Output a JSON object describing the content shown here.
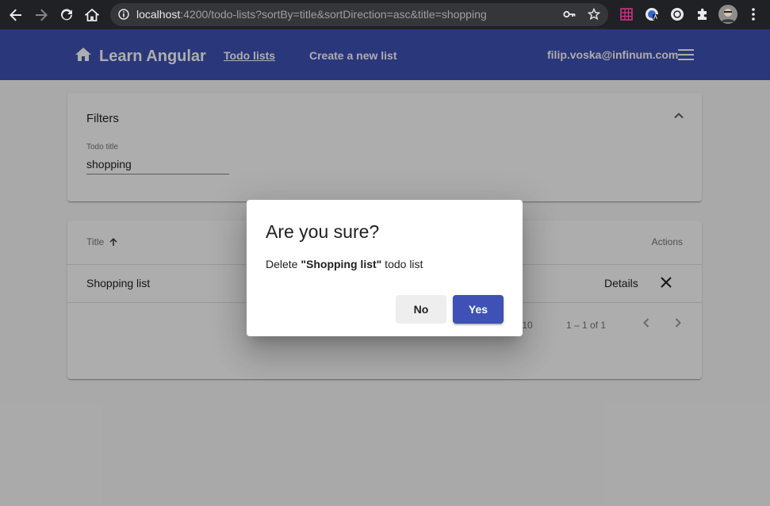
{
  "browser": {
    "url_host": "localhost",
    "url_rest": ":4200/todo-lists?sortBy=title&sortDirection=asc&title=shopping",
    "icons": [
      "back-icon",
      "forward-icon",
      "reload-icon",
      "home-icon",
      "info-icon",
      "key-icon",
      "star-icon",
      "extension-grid-icon",
      "extension-translate-icon",
      "extension-circle-icon",
      "puzzle-icon",
      "profile-avatar",
      "kebab-menu-icon"
    ]
  },
  "toolbar": {
    "brand": "Learn Angular",
    "nav": [
      "Todo lists",
      "Create a new list"
    ],
    "user_email": "filip.voska@infinum.com",
    "bg_color": "#3f51b5"
  },
  "filters": {
    "title": "Filters",
    "todo_title_label": "Todo title",
    "todo_title_value": "shopping"
  },
  "table": {
    "header_title": "Title",
    "header_actions": "Actions",
    "rows": [
      {
        "title": "Shopping list",
        "details": "Details"
      }
    ],
    "paginator": {
      "page_size_text": "e: 10",
      "range": "1 – 1 of 1"
    }
  },
  "dialog": {
    "title": "Are you sure?",
    "message_prefix": "Delete ",
    "message_bold": "\"Shopping list\"",
    "message_suffix": " todo list",
    "no_label": "No",
    "yes_label": "Yes"
  }
}
